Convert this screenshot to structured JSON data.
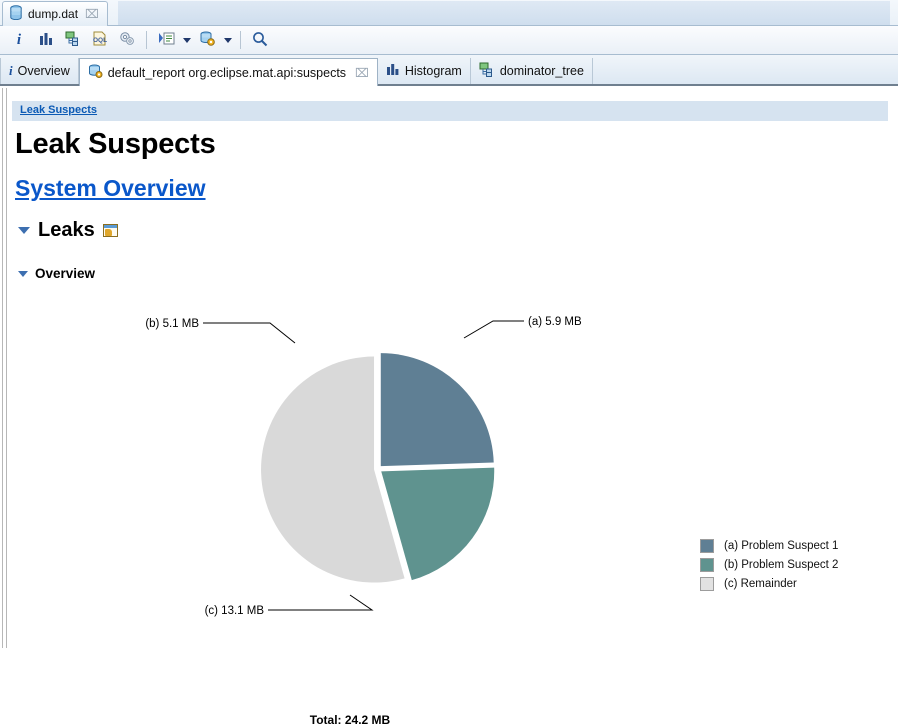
{
  "editor": {
    "tab_title": "dump.dat",
    "tab_icon": "heap-dump-icon",
    "close_label": "⌧"
  },
  "toolbar": {
    "buttons": [
      {
        "name": "inspector-button",
        "icon": "info-icon",
        "label": "i"
      },
      {
        "name": "histogram-button",
        "icon": "histogram-icon",
        "label": ""
      },
      {
        "name": "dominator-tree-button",
        "icon": "tree-icon",
        "label": ""
      },
      {
        "name": "oql-button",
        "icon": "oql-icon",
        "label": "OQL"
      },
      {
        "name": "calculate-retained-button",
        "icon": "gears-icon",
        "label": ""
      },
      {
        "name": "run-expert-system-button",
        "icon": "run-report-icon",
        "label": ""
      },
      {
        "name": "open-query-browser-button",
        "icon": "query-browser-icon",
        "label": ""
      },
      {
        "name": "search-button",
        "icon": "search-icon",
        "label": ""
      }
    ]
  },
  "view_tabs": [
    {
      "label": "Overview",
      "icon": "info-icon",
      "active": false,
      "closable": false
    },
    {
      "label": "default_report  org.eclipse.mat.api:suspects",
      "icon": "report-icon",
      "active": true,
      "closable": true
    },
    {
      "label": "Histogram",
      "icon": "histogram-icon",
      "active": false,
      "closable": false
    },
    {
      "label": "dominator_tree",
      "icon": "tree-icon",
      "active": false,
      "closable": false
    }
  ],
  "report": {
    "breadcrumb": "Leak Suspects",
    "page_title": "Leak Suspects",
    "system_overview_link": "System Overview",
    "leaks_heading": "Leaks",
    "leaks_icon": "report-window-icon",
    "overview_heading": "Overview"
  },
  "chart_data": {
    "type": "pie",
    "title": "",
    "total_label": "Total: 24.2 MB",
    "total_value": 24.2,
    "unit": "MB",
    "legend_position": "right",
    "categories": [
      "(a) Problem Suspect 1",
      "(b) Problem Suspect 2",
      "(c) Remainder"
    ],
    "keys": [
      "(a)",
      "(b)",
      "(c)"
    ],
    "names": [
      "Problem Suspect 1",
      "Problem Suspect 2",
      "Remainder"
    ],
    "values": [
      5.9,
      5.1,
      13.1
    ],
    "value_labels": [
      "5.9 MB",
      "5.1 MB",
      "13.1 MB"
    ],
    "callout_labels": [
      "(a)  5.9 MB",
      "(b)  5.1 MB",
      "(c)  13.1 MB"
    ],
    "colors": [
      "#5f7f94",
      "#5f938f",
      "#d9d9d9"
    ],
    "percentages": [
      24.4,
      21.1,
      54.5
    ]
  },
  "colors": {
    "accent_link": "#0a57ca",
    "breadcrumb_bg": "#d6e3f0",
    "slice_a": "#5f7f94",
    "slice_b": "#5f938f",
    "slice_c": "#d9d9d9"
  }
}
